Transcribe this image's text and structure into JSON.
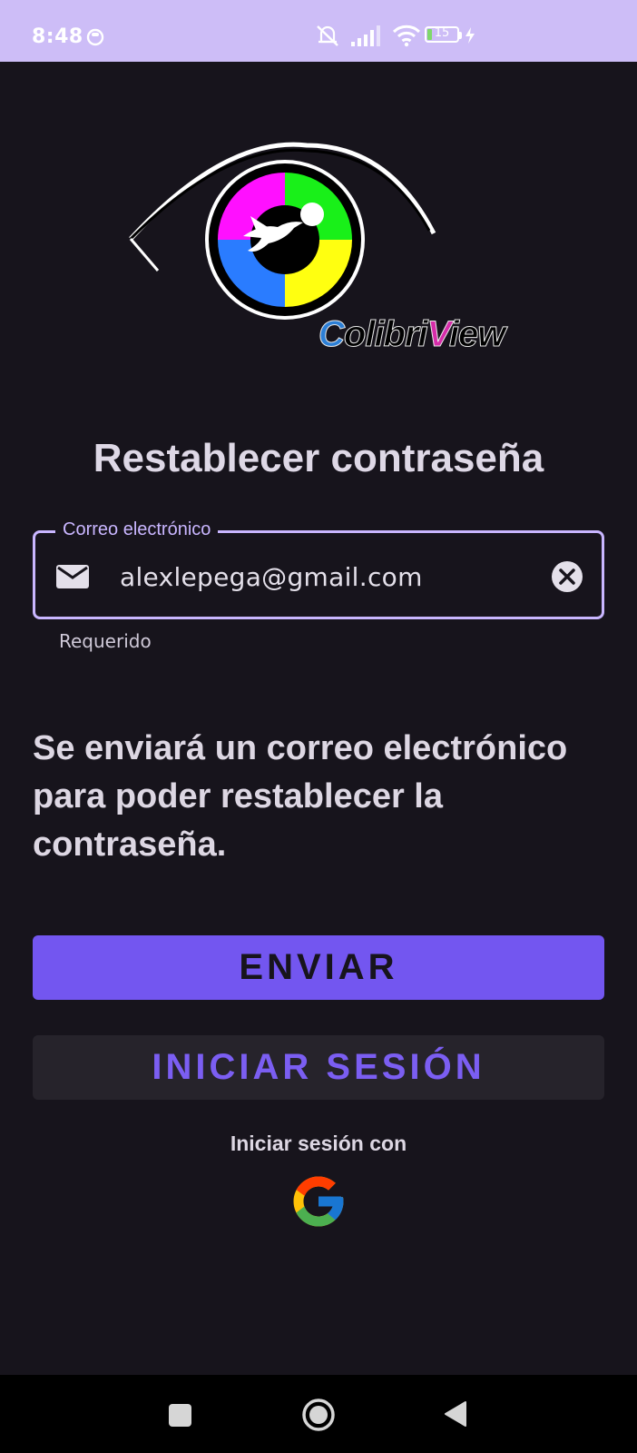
{
  "status_bar": {
    "time": "8:48",
    "battery_level": "15",
    "icons": [
      "app-notification-icon",
      "mute-icon",
      "signal-icon",
      "wifi-icon",
      "battery-icon",
      "charging-icon"
    ]
  },
  "logo": {
    "brand_first": "C",
    "brand_mid": "olibri",
    "brand_v": "V",
    "brand_end": "iew",
    "colors": [
      "#ff10ff",
      "#19f019",
      "#2a7cff",
      "#ffff10"
    ]
  },
  "title": "Restablecer contraseña",
  "email_field": {
    "label": "Correo electrónico",
    "value": "alexlepega@gmail.com",
    "helper": "Requerido",
    "accent": "#c9b6ff"
  },
  "info_text": "Se enviará un correo electrónico para poder restablecer la contraseña.",
  "buttons": {
    "send": "ENVIAR",
    "login": "INICIAR SESIÓN",
    "primary_color": "#7356f0"
  },
  "social": {
    "label": "Iniciar sesión con",
    "provider": "google-icon"
  },
  "nav_bar": {
    "icons": [
      "recents-icon",
      "home-icon",
      "back-icon"
    ]
  }
}
